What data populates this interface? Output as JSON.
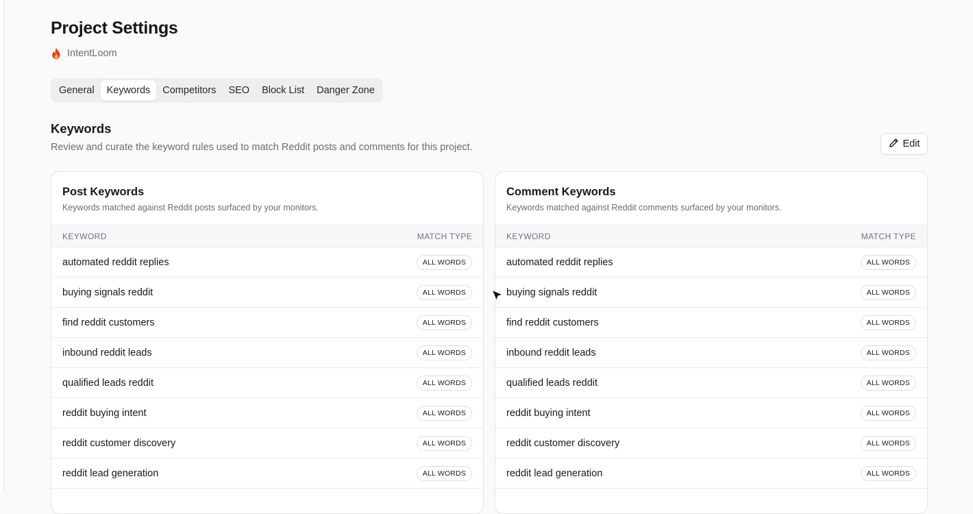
{
  "header": {
    "title": "Project Settings",
    "project_name": "IntentLoom",
    "project_icon": "flame-icon",
    "accent": "#e8430f"
  },
  "tabs": [
    {
      "label": "General",
      "active": false
    },
    {
      "label": "Keywords",
      "active": true
    },
    {
      "label": "Competitors",
      "active": false
    },
    {
      "label": "SEO",
      "active": false
    },
    {
      "label": "Block List",
      "active": false
    },
    {
      "label": "Danger Zone",
      "active": false
    }
  ],
  "section": {
    "title": "Keywords",
    "description": "Review and curate the keyword rules used to match Reddit posts and comments for this project.",
    "edit_label": "Edit",
    "edit_icon": "pencil-icon"
  },
  "post_keywords": {
    "title": "Post Keywords",
    "description": "Keywords matched against Reddit posts surfaced by your monitors.",
    "col_keyword": "KEYWORD",
    "col_match": "MATCH TYPE",
    "rows": [
      {
        "keyword": "automated reddit replies",
        "match": "ALL WORDS"
      },
      {
        "keyword": "buying signals reddit",
        "match": "ALL WORDS"
      },
      {
        "keyword": "find reddit customers",
        "match": "ALL WORDS"
      },
      {
        "keyword": "inbound reddit leads",
        "match": "ALL WORDS"
      },
      {
        "keyword": "qualified leads reddit",
        "match": "ALL WORDS"
      },
      {
        "keyword": "reddit buying intent",
        "match": "ALL WORDS"
      },
      {
        "keyword": "reddit customer discovery",
        "match": "ALL WORDS"
      },
      {
        "keyword": "reddit lead generation",
        "match": "ALL WORDS"
      }
    ]
  },
  "comment_keywords": {
    "title": "Comment Keywords",
    "description": "Keywords matched against Reddit comments surfaced by your monitors.",
    "col_keyword": "KEYWORD",
    "col_match": "MATCH TYPE",
    "rows": [
      {
        "keyword": "automated reddit replies",
        "match": "ALL WORDS"
      },
      {
        "keyword": "buying signals reddit",
        "match": "ALL WORDS"
      },
      {
        "keyword": "find reddit customers",
        "match": "ALL WORDS"
      },
      {
        "keyword": "inbound reddit leads",
        "match": "ALL WORDS"
      },
      {
        "keyword": "qualified leads reddit",
        "match": "ALL WORDS"
      },
      {
        "keyword": "reddit buying intent",
        "match": "ALL WORDS"
      },
      {
        "keyword": "reddit customer discovery",
        "match": "ALL WORDS"
      },
      {
        "keyword": "reddit lead generation",
        "match": "ALL WORDS"
      }
    ]
  }
}
